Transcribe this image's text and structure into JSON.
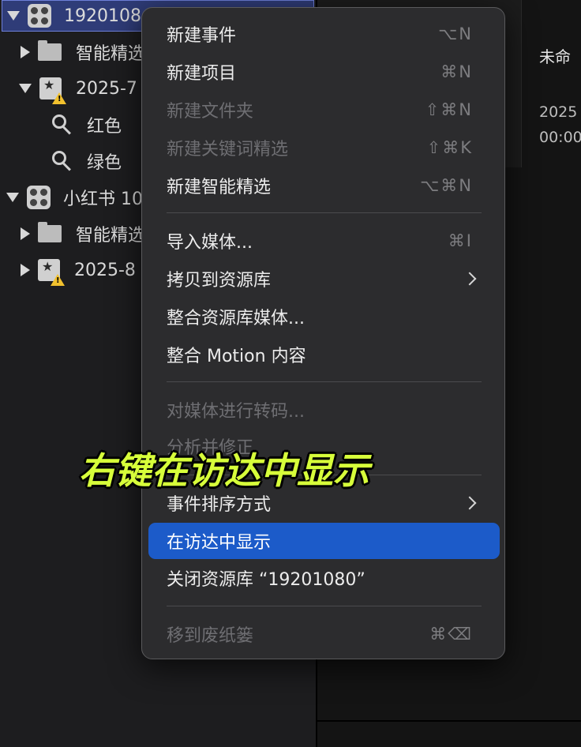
{
  "sidebar": {
    "rows": [
      {
        "label": "1920108",
        "kind": "library"
      },
      {
        "label": "智能精选",
        "kind": "folder"
      },
      {
        "label": "2025-7",
        "kind": "event"
      },
      {
        "label": "红色",
        "kind": "keyword"
      },
      {
        "label": "绿色",
        "kind": "keyword"
      },
      {
        "label": "小红书 10",
        "kind": "library"
      },
      {
        "label": "智能精选",
        "kind": "folder"
      },
      {
        "label": "2025-8",
        "kind": "event"
      }
    ]
  },
  "browser": {
    "clip_title": "未命",
    "clip_date": "2025",
    "clip_time": "00:00"
  },
  "menu": {
    "items": [
      {
        "label": "新建事件",
        "shortcut": "⌥N",
        "enabled": true
      },
      {
        "label": "新建项目",
        "shortcut": "⌘N",
        "enabled": true
      },
      {
        "label": "新建文件夹",
        "shortcut": "⇧⌘N",
        "enabled": false
      },
      {
        "label": "新建关键词精选",
        "shortcut": "⇧⌘K",
        "enabled": false
      },
      {
        "label": "新建智能精选",
        "shortcut": "⌥⌘N",
        "enabled": true
      },
      {
        "label": "导入媒体...",
        "shortcut": "⌘I",
        "enabled": true
      },
      {
        "label": "拷贝到资源库",
        "shortcut": "",
        "enabled": true,
        "submenu": true
      },
      {
        "label": "整合资源库媒体...",
        "shortcut": "",
        "enabled": true
      },
      {
        "label": "整合 Motion 内容",
        "shortcut": "",
        "enabled": true
      },
      {
        "label": "对媒体进行转码...",
        "shortcut": "",
        "enabled": false
      },
      {
        "label": "分析并修正",
        "shortcut": "",
        "enabled": false
      },
      {
        "label": "事件排序方式",
        "shortcut": "",
        "enabled": true,
        "submenu": true
      },
      {
        "label": "在访达中显示",
        "shortcut": "",
        "enabled": true,
        "highlighted": true
      },
      {
        "label": "关闭资源库 “19201080”",
        "shortcut": "",
        "enabled": true
      },
      {
        "label": "移到废纸篓",
        "shortcut": "⌘⌫",
        "enabled": false
      }
    ]
  },
  "caption": "右键在访达中显示",
  "colors": {
    "menu_bg": "#2c2c2e",
    "highlight": "#1c5bc9",
    "caption": "#d7ff3a",
    "sidebar_selection": "#2f3c78"
  }
}
